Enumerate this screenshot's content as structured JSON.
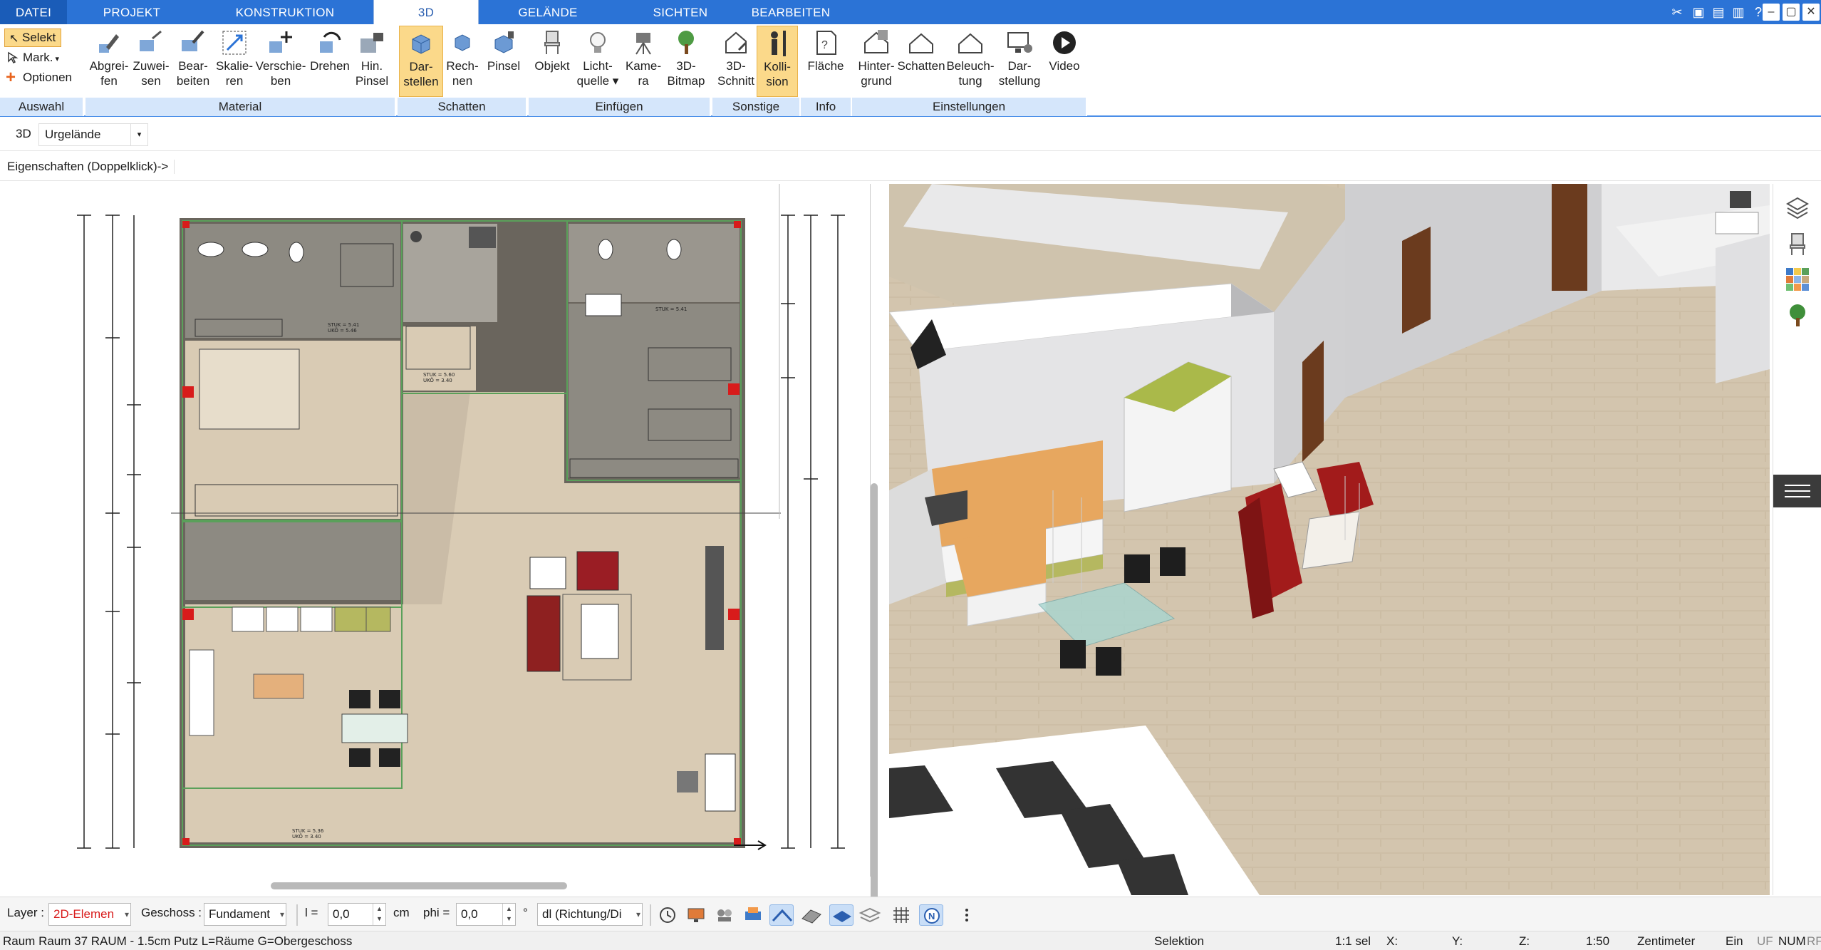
{
  "tabs": [
    "DATEI",
    "PROJEKT",
    "KONSTRUKTION",
    "3D",
    "GELÄNDE",
    "SICHTEN",
    "BEARBEITEN"
  ],
  "active_tab": "3D",
  "auswahl": {
    "select": "Selekt",
    "mark": "Mark.",
    "options": "Optionen",
    "label": "Auswahl"
  },
  "groups": {
    "material": {
      "label": "Material",
      "buttons": [
        {
          "l1": "Abgrei-",
          "l2": "fen"
        },
        {
          "l1": "Zuwei-",
          "l2": "sen"
        },
        {
          "l1": "Bear-",
          "l2": "beiten"
        },
        {
          "l1": "Skalie-",
          "l2": "ren"
        },
        {
          "l1": "Verschie-",
          "l2": "ben"
        },
        {
          "l1": "Drehen",
          "l2": ""
        },
        {
          "l1": "Hin.",
          "l2": "Pinsel"
        }
      ]
    },
    "schatten": {
      "label": "Schatten",
      "buttons": [
        {
          "l1": "Dar-",
          "l2": "stellen"
        },
        {
          "l1": "Rech-",
          "l2": "nen"
        },
        {
          "l1": "Pinsel",
          "l2": ""
        }
      ]
    },
    "einfuegen": {
      "label": "Einfügen",
      "buttons": [
        {
          "l1": "Objekt",
          "l2": ""
        },
        {
          "l1": "Licht-",
          "l2": "quelle ▾"
        },
        {
          "l1": "Kame-",
          "l2": "ra"
        },
        {
          "l1": "3D-",
          "l2": "Bitmap"
        }
      ]
    },
    "sonstige": {
      "label": "Sonstige",
      "buttons": [
        {
          "l1": "3D-",
          "l2": "Schnitt"
        },
        {
          "l1": "Kolli-",
          "l2": "sion"
        }
      ]
    },
    "info": {
      "label": "Info",
      "buttons": [
        {
          "l1": "Fläche",
          "l2": ""
        }
      ]
    },
    "einstellungen": {
      "label": "Einstellungen",
      "buttons": [
        {
          "l1": "Hinter-",
          "l2": "grund"
        },
        {
          "l1": "Schatten",
          "l2": ""
        },
        {
          "l1": "Beleuch-",
          "l2": "tung"
        },
        {
          "l1": "Dar-",
          "l2": "stellung"
        },
        {
          "l1": "Video",
          "l2": ""
        }
      ]
    }
  },
  "subbar": {
    "mode": "3D",
    "terrain": "Urgelände"
  },
  "properties_hint": "Eigenschaften (Doppelklick)->",
  "plan": {
    "labels": {
      "stuk1": "STUK = 5.41",
      "stuk2": "UKÖ = 5.46",
      "stuk3": "STUK = 5.60",
      "stuk4": "UKÖ = 3.40",
      "stuk5": "STUK = 5.36",
      "stuk6": "UKÖ = 3.40",
      "stuk7": "STUK = 5.41"
    }
  },
  "bottom": {
    "layer_label": "Layer :",
    "layer_value": "2D-Elemen",
    "geschoss_label": "Geschoss :",
    "geschoss_value": "Fundament",
    "l_label": "l =",
    "l_value": "0,0",
    "l_unit": "cm",
    "phi_label": "phi =",
    "phi_value": "0,0",
    "phi_unit": "°",
    "dl_value": "dl (Richtung/Di"
  },
  "status": {
    "left": "Raum Raum 37 RAUM - 1.5cm Putz L=Räume G=Obergeschoss",
    "mode": "Selektion",
    "sel": "1:1 sel",
    "x": "X:",
    "y": "Y:",
    "z": "Z:",
    "scale": "1:50",
    "unit": "Zentimeter",
    "ein": "Ein",
    "uf": "UF",
    "num": "NUM",
    "rf": "RF"
  },
  "colors": {
    "ribbon_blue": "#2b73d6",
    "group_label_bg": "#d5e6fb",
    "active_button": "#fbd98a",
    "wall_green": "#5aa05a",
    "floor_wood": "#d9cbb4",
    "sofa_red": "#a31c1c",
    "status_red": "#d81b1b"
  }
}
